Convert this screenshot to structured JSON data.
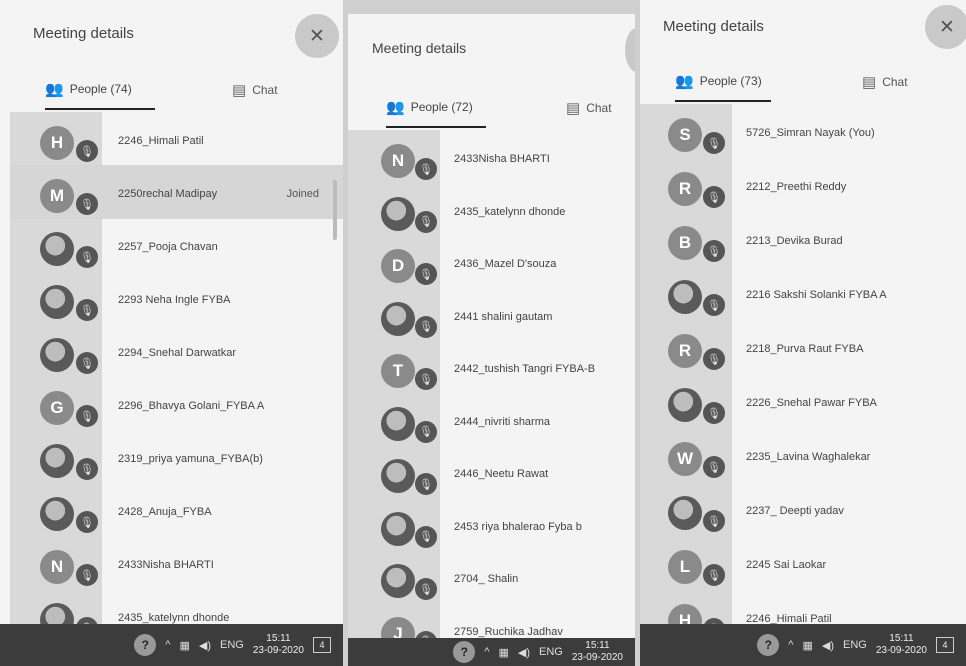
{
  "panels": [
    {
      "title": "Meeting details",
      "close_icon": "close-icon",
      "tabs": {
        "people": "People (74)",
        "chat": "Chat"
      },
      "participants": [
        {
          "initial": "H",
          "photo": false,
          "name": "2246_Himali Patil"
        },
        {
          "initial": "M",
          "photo": false,
          "name": "2250rechal Madipay",
          "status": "Joined"
        },
        {
          "initial": "",
          "photo": true,
          "name": "2257_Pooja Chavan"
        },
        {
          "initial": "",
          "photo": true,
          "name": "2293 Neha Ingle FYBA"
        },
        {
          "initial": "",
          "photo": true,
          "name": "2294_Snehal Darwatkar"
        },
        {
          "initial": "G",
          "photo": false,
          "name": "2296_Bhavya Golani_FYBA A"
        },
        {
          "initial": "",
          "photo": true,
          "name": "2319_priya yamuna_FYBA(b)"
        },
        {
          "initial": "",
          "photo": true,
          "name": "2428_Anuja_FYBA"
        },
        {
          "initial": "N",
          "photo": false,
          "name": "2433Nisha BHARTI"
        },
        {
          "initial": "",
          "photo": true,
          "name": "2435_katelynn dhonde"
        }
      ],
      "taskbar": {
        "lang": "ENG",
        "time": "15:11",
        "date": "23-09-2020",
        "notif": "4"
      }
    },
    {
      "title": "Meeting details",
      "close_icon": "close-icon",
      "tabs": {
        "people": "People (72)",
        "chat": "Chat"
      },
      "participants": [
        {
          "initial": "N",
          "photo": false,
          "name": "2433Nisha BHARTI"
        },
        {
          "initial": "",
          "photo": true,
          "name": "2435_katelynn dhonde"
        },
        {
          "initial": "D",
          "photo": false,
          "name": "2436_Mazel D'souza"
        },
        {
          "initial": "",
          "photo": true,
          "name": "2441 shalini gautam"
        },
        {
          "initial": "T",
          "photo": false,
          "name": "2442_tushish Tangri FYBA-B"
        },
        {
          "initial": "",
          "photo": true,
          "name": "2444_nivriti sharma"
        },
        {
          "initial": "",
          "photo": true,
          "name": "2446_Neetu Rawat"
        },
        {
          "initial": "",
          "photo": true,
          "name": "2453 riya bhalerao Fyba b"
        },
        {
          "initial": "",
          "photo": true,
          "name": "2704_ Shalin"
        },
        {
          "initial": "J",
          "photo": false,
          "name": "2759_Ruchika Jadhav"
        }
      ],
      "taskbar": {
        "lang": "ENG",
        "time": "15:11",
        "date": "23-09-2020",
        "notif": ""
      }
    },
    {
      "title": "Meeting details",
      "close_icon": "close-icon",
      "tabs": {
        "people": "People (73)",
        "chat": "Chat"
      },
      "participants": [
        {
          "initial": "S",
          "photo": false,
          "name": "5726_Simran Nayak (You)"
        },
        {
          "initial": "R",
          "photo": false,
          "name": "2212_Preethi Reddy"
        },
        {
          "initial": "B",
          "photo": false,
          "name": "2213_Devika Burad"
        },
        {
          "initial": "",
          "photo": true,
          "name": "2216 Sakshi Solanki FYBA A"
        },
        {
          "initial": "R",
          "photo": false,
          "name": "2218_Purva Raut FYBA"
        },
        {
          "initial": "",
          "photo": true,
          "name": "2226_Snehal Pawar FYBA"
        },
        {
          "initial": "W",
          "photo": false,
          "name": "2235_Lavina Waghalekar"
        },
        {
          "initial": "",
          "photo": true,
          "name": "2237_ Deepti yadav"
        },
        {
          "initial": "L",
          "photo": false,
          "name": "2245 Sai Laokar"
        },
        {
          "initial": "H",
          "photo": false,
          "name": "2246_Himali Patil"
        }
      ],
      "taskbar": {
        "lang": "ENG",
        "time": "15:11",
        "date": "23-09-2020",
        "notif": "4"
      }
    }
  ]
}
